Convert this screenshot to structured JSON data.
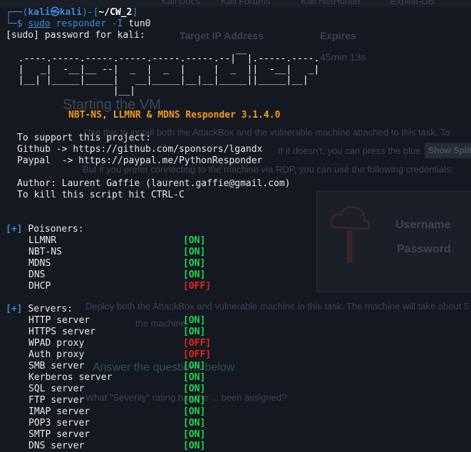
{
  "background": {
    "tabs": [
      "Kali Docs",
      "Kali Forums",
      "Kali NetHunter",
      "Exploit-DB"
    ],
    "target_ip_header": "Target IP Address",
    "expires_header": "Expires",
    "expires_value": "45min 13s",
    "heading": "Starting the VM",
    "para1": "Use this to install both the AttackBox and the vulnerable machine attached to this task. To",
    "para2": "If it doesn't, you can press the blue",
    "show_split": "Show Split",
    "para3": "But if you prefer connecting to the machine via RDP, you can use the following credentials:",
    "username": "Username",
    "password": "Password",
    "para4": "Deploy both the AttackBox and vulnerable machine in this task. The machine will take about 5 mi",
    "para5": "the machine.",
    "questions": "Answer the questions below",
    "question1": "What \"Severity\" rating has the ... been assigned?"
  },
  "prompt": {
    "corner_top": "┌──(",
    "user_host": "kali㉿kali",
    "mid": ")-[",
    "path": "~/CW_2",
    "end": "]",
    "corner_bottom": "└─$",
    "sudo": "sudo",
    "command": "responder -I",
    "iface": "tun0"
  },
  "sudo_prompt": "[sudo] password for kali:",
  "banner": {
    "ascii": [
      "                                         __",
      "  .----.-----.-----.-----.-----.-----.--|  |.-----.----.",
      "  |   _|  -__|__ --|  _  |  _  |     |  _  ||  -__|   _|",
      "  |__| |_____|_____|   __|_____|__|__|_____||_____|__|",
      "                   |__|"
    ],
    "title": "NBT-NS, LLMNR & MDNS Responder 3.1.4.0"
  },
  "support": {
    "line": "To support this project:",
    "github": "Github -> https://github.com/sponsors/lgandx",
    "paypal": "Paypal  -> https://paypal.me/PythonResponder",
    "author": "Author: Laurent Gaffie (laurent.gaffie@gmail.com)",
    "kill": "To kill this script hit CTRL-C"
  },
  "poisoners": {
    "tag": "[+]",
    "label": "Poisoners:",
    "items": [
      {
        "name": "LLMNR",
        "status": "[ON]"
      },
      {
        "name": "NBT-NS",
        "status": "[ON]"
      },
      {
        "name": "MDNS",
        "status": "[ON]"
      },
      {
        "name": "DNS",
        "status": "[ON]"
      },
      {
        "name": "DHCP",
        "status": "[OFF]"
      }
    ]
  },
  "servers": {
    "tag": "[+]",
    "label": "Servers:",
    "items": [
      {
        "name": "HTTP server",
        "status": "[ON]"
      },
      {
        "name": "HTTPS server",
        "status": "[ON]"
      },
      {
        "name": "WPAD proxy",
        "status": "[OFF]"
      },
      {
        "name": "Auth proxy",
        "status": "[OFF]"
      },
      {
        "name": "SMB server",
        "status": "[ON]"
      },
      {
        "name": "Kerberos server",
        "status": "[ON]"
      },
      {
        "name": "SQL server",
        "status": "[ON]"
      },
      {
        "name": "FTP server",
        "status": "[ON]"
      },
      {
        "name": "IMAP server",
        "status": "[ON]"
      },
      {
        "name": "POP3 server",
        "status": "[ON]"
      },
      {
        "name": "SMTP server",
        "status": "[ON]"
      },
      {
        "name": "DNS server",
        "status": "[ON]"
      }
    ]
  },
  "colors": {
    "on": "#21d94a",
    "off": "#e8241c",
    "accent": "#3d87d8",
    "title": "#f39a18"
  }
}
